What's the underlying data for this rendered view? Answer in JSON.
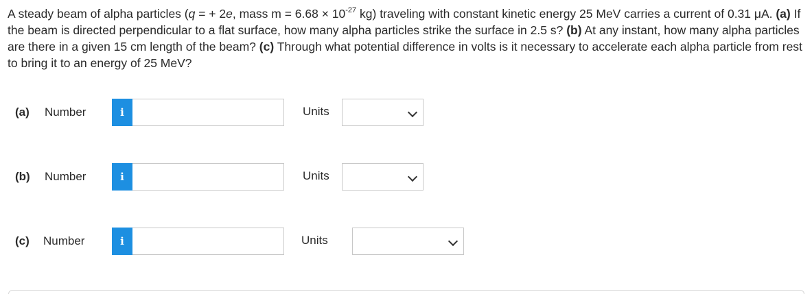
{
  "question": {
    "s1": "A steady beam of alpha particles (",
    "q_var": "q",
    "s2": " = + 2",
    "e_var": "e",
    "s3": ", mass m = 6.68 × 10",
    "exp": "-27",
    "s4": " kg) traveling with constant kinetic energy 25 MeV carries a current of 0.31 μA. ",
    "a_tag": "(a)",
    "a_text": " If the beam is directed perpendicular to a flat surface, how many alpha particles strike the surface in 2.5 s? ",
    "b_tag": "(b)",
    "b_text": " At any instant, how many alpha particles are there in a given 15 cm length of the beam? ",
    "c_tag": "(c)",
    "c_text": " Through what potential difference in volts is it necessary to accelerate each alpha particle from rest to bring it to an energy of 25 MeV?"
  },
  "parts": [
    {
      "label": "(a)",
      "number_label": "Number",
      "info_glyph": "i",
      "value": "",
      "units_label": "Units",
      "units_value": ""
    },
    {
      "label": "(b)",
      "number_label": "Number",
      "info_glyph": "i",
      "value": "",
      "units_label": "Units",
      "units_value": ""
    },
    {
      "label": "(c)",
      "number_label": "Number",
      "info_glyph": "i",
      "value": "",
      "units_label": "Units",
      "units_value": ""
    }
  ],
  "colors": {
    "info_button": "#1d8fe1",
    "border": "#c8c8c8"
  }
}
